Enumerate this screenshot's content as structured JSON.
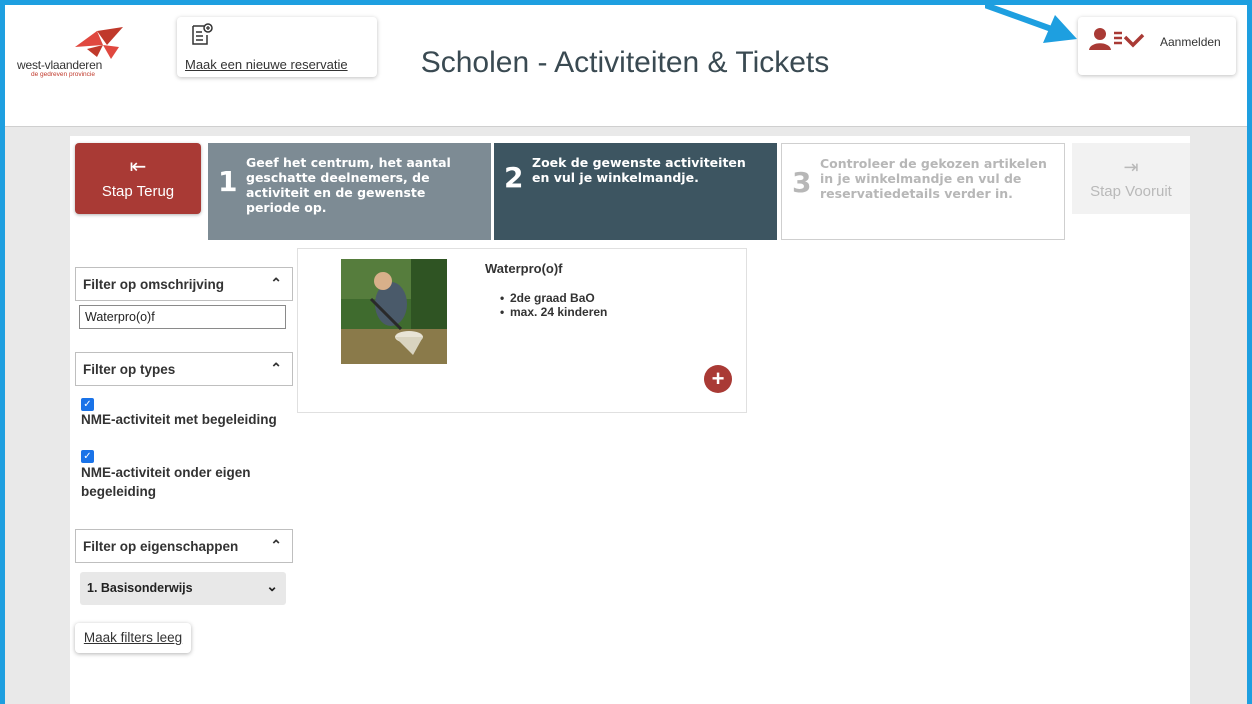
{
  "header": {
    "logo_text": "west-vlaanderen",
    "logo_subtext": "de gedreven provincie",
    "new_reservation_label": "Maak een nieuwe reservatie",
    "title": "Scholen - Activiteiten & Tickets",
    "login_label": "Aanmelden"
  },
  "nav": {
    "back_label": "Stap Terug",
    "forward_label": "Stap Vooruit",
    "steps": [
      {
        "number": "1",
        "text": "Geef het centrum, het aantal geschatte deelnemers, de activiteit en de gewenste periode op."
      },
      {
        "number": "2",
        "text": "Zoek de gewenste activiteiten en vul je winkelmandje."
      },
      {
        "number": "3",
        "text": "Controleer de gekozen artikelen in je winkelmandje en vul de reservatiedetails verder in."
      }
    ]
  },
  "filters": {
    "description_label": "Filter op omschrijving",
    "description_value": "Waterpro(o)f",
    "types_label": "Filter op types",
    "types": [
      {
        "label": "NME-activiteit met begeleiding",
        "checked": true
      },
      {
        "label": "NME-activiteit onder eigen begeleiding",
        "checked": true
      }
    ],
    "properties_label": "Filter op eigenschappen",
    "properties_selected": "1. Basisonderwijs",
    "clear_label": "Maak filters leeg"
  },
  "activity": {
    "title": "Waterpro(o)f",
    "details": [
      "2de graad BaO",
      "max. 24 kinderen"
    ]
  },
  "colors": {
    "accent_red": "#a93a35",
    "step_active": "#3d5561",
    "step_done": "#7d8b94",
    "frame_blue": "#1e9fe0"
  }
}
